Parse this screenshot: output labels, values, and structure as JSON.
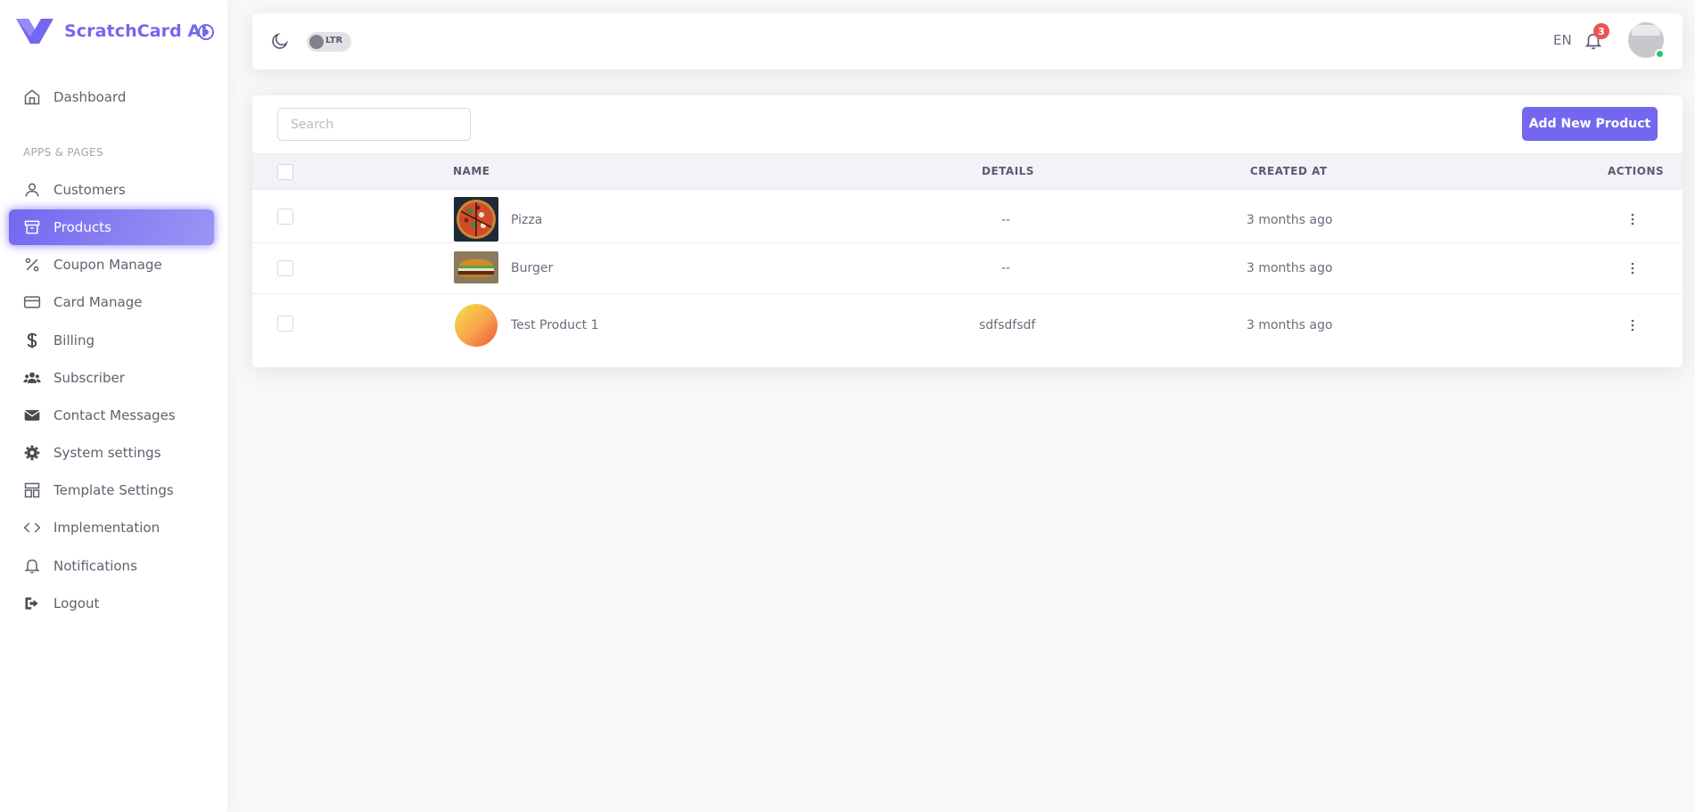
{
  "brand": {
    "name": "ScratchCard AI",
    "accent": "#7367f0"
  },
  "sidebar": {
    "section_header": "APPS & PAGES",
    "items": [
      {
        "label": "Dashboard",
        "icon": "home-icon"
      },
      {
        "label": "Customers",
        "icon": "user-icon"
      },
      {
        "label": "Products",
        "icon": "archive-icon",
        "active": true
      },
      {
        "label": "Coupon Manage",
        "icon": "percent-icon"
      },
      {
        "label": "Card Manage",
        "icon": "credit-card-icon"
      },
      {
        "label": "Billing",
        "icon": "dollar-icon"
      },
      {
        "label": "Subscriber",
        "icon": "users-icon"
      },
      {
        "label": "Contact Messages",
        "icon": "envelope-icon"
      },
      {
        "label": "System settings",
        "icon": "gear-icon"
      },
      {
        "label": "Template Settings",
        "icon": "layout-icon"
      },
      {
        "label": "Implementation",
        "icon": "code-icon"
      },
      {
        "label": "Notifications",
        "icon": "bell-icon"
      },
      {
        "label": "Logout",
        "icon": "logout-icon"
      }
    ]
  },
  "navbar": {
    "direction_toggle": "LTR",
    "language": "EN",
    "notification_count": "3"
  },
  "products": {
    "search_placeholder": "Search",
    "add_button": "Add New Product",
    "columns": {
      "name": "NAME",
      "details": "DETAILS",
      "created_at": "CREATED AT",
      "actions": "ACTIONS"
    },
    "rows": [
      {
        "name": "Pizza",
        "details": "--",
        "created_at": "3 months ago"
      },
      {
        "name": "Burger",
        "details": "--",
        "created_at": "3 months ago"
      },
      {
        "name": "Test Product 1",
        "details": "sdfsdfsdf",
        "created_at": "3 months ago"
      }
    ]
  }
}
